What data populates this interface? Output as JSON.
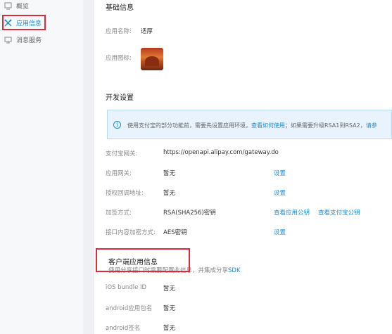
{
  "sidebar": {
    "items": [
      {
        "label": "概览",
        "icon": "overview-icon"
      },
      {
        "label": "应用信息",
        "icon": "app-info-icon",
        "active": true
      },
      {
        "label": "消息服务",
        "icon": "message-icon"
      }
    ]
  },
  "basic": {
    "title": "基础信息",
    "name_label": "应用名称:",
    "name_value": "适厚",
    "icon_label": "应用图标:"
  },
  "dev": {
    "title": "开发设置",
    "notice_text": "使用支付宝的部分功能前，需要先设置应用环境，",
    "notice_link1": "查看如何使用",
    "notice_text2": "；如果需要升级RSA1到RSA2，",
    "notice_link2": "请参",
    "rows": [
      {
        "label": "支付宝网关:",
        "value": "https://openapi.alipay.com/gateway.do"
      },
      {
        "label": "应用网关:",
        "value": "暂无",
        "link": "设置"
      },
      {
        "label": "授权回调地址:",
        "value": "暂无",
        "link": "设置"
      },
      {
        "label": "加签方式:",
        "value": "RSA(SHA256)密钥",
        "link": "查看应用公钥",
        "link2": "查看支付宝公钥"
      },
      {
        "label": "接口内容加密方式:",
        "value": "AES密钥",
        "link": "设置"
      }
    ]
  },
  "client": {
    "title": "客户端应用信息",
    "note": "使用分享接口时需要配置此信息，并集成分享",
    "note_link": "SDK",
    "rows": [
      {
        "label": "iOS bundle ID",
        "value": "暂无"
      },
      {
        "label": "android应用包名",
        "value": "暂无"
      },
      {
        "label": "android签名",
        "value": "暂无"
      }
    ]
  },
  "colors": {
    "accent": "#1a8cd8",
    "highlight": "#e0283c",
    "notice_bg": "#e8f3fd"
  }
}
